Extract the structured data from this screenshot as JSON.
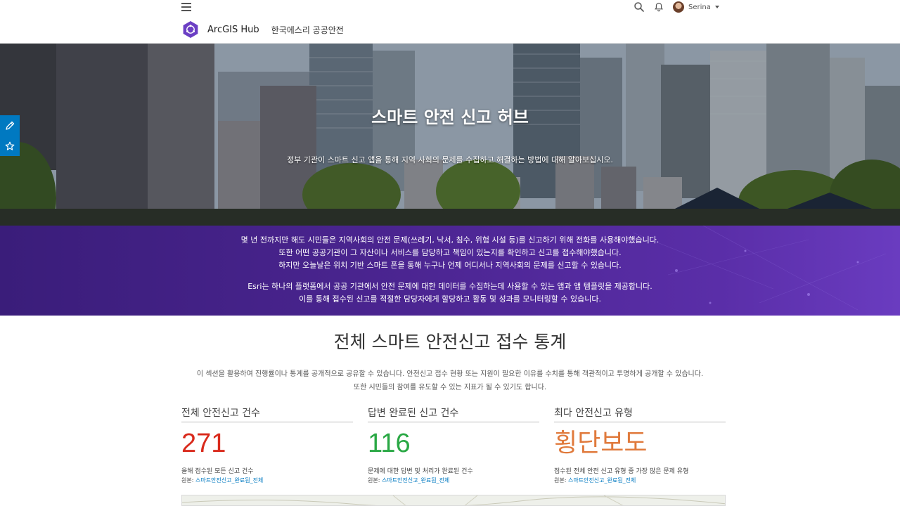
{
  "header": {
    "app_name": "ArcGIS Hub",
    "site_name": "한국에스리 공공안전",
    "user_name": "Serina"
  },
  "hero": {
    "title": "스마트 안전 신고 허브",
    "subtitle": "정부 기관이 스마트 신고 앱을 통해 지역 사회의 문제를 수집하고 해결하는 방법에 대해 알아보십시오."
  },
  "band": {
    "para1": [
      "몇 년 전까지만 해도 시민들은 지역사회의 안전 문제(쓰레기, 낙서, 침수, 위험 시설 등)를 신고하기 위해 전화를 사용해야했습니다.",
      "또한 어떤 공공기관이 그 자산이나 서비스를 담당하고 책임이 있는지를 확인하고 신고를 접수해야했습니다.",
      "하지만 오늘날은 위치 기반 스마트 폰을 통해 누구나 언제 어디서나 지역사회의 문제를 신고할 수 있습니다."
    ],
    "para2": [
      "Esri는 하나의 플랫폼에서 공공 기관에서 안전 문제에 대한 데이터를 수집하는데 사용할 수 있는 앱과 앱 템플릿을 제공합니다.",
      "이를 통해 접수된 신고를 적절한 담당자에게 할당하고 활동 및 성과를 모니터링할 수 있습니다."
    ]
  },
  "stats": {
    "title": "전체 스마트 안전신고 접수 통계",
    "desc_line1": "이 섹션을 활용하여 진행률이나 통계를 공개적으로 공유할 수 있습니다. 안전신고 접수 현황 또는 지원이 필요한 이유를 수치를 통해 객관적이고 투명하게 공개할 수 있습니다.",
    "desc_line2": "또한 시민들의 참여를 유도할 수 있는 지표가 될 수 있기도 합니다.",
    "cards": [
      {
        "title": "전체 안전신고 건수",
        "value": "271",
        "color": "#d92a1c",
        "caption": "올해 접수된 모든 신고 건수",
        "source_label": "원본:",
        "source_link": "스마트안전신고_완료됨_전체"
      },
      {
        "title": "답변 완료된 신고 건수",
        "value": "116",
        "color": "#2aa845",
        "caption": "문제에 대한 답변 및 처리가 완료된 건수",
        "source_label": "원본:",
        "source_link": "스마트안전신고_완료됨_전체"
      },
      {
        "title": "최다 안전신고 유형",
        "value": "횡단보도",
        "color": "#e07a3c",
        "caption": "접수된 전체 안전 신고 유형 중 가장 많은 문제 유형",
        "source_label": "원본:",
        "source_link": "스마트안전신고_완료됨_전체"
      }
    ]
  },
  "icons": {
    "menu": "hamburger-menu-icon",
    "search": "search-icon",
    "notifications": "bell-icon",
    "edit": "pencil-icon",
    "favorite": "star-icon",
    "logo": "arcgis-hub-logo"
  },
  "colors": {
    "accent_blue": "#0079c1",
    "band_purple": "#4b2591",
    "logo_purple": "#6b3fc4"
  }
}
